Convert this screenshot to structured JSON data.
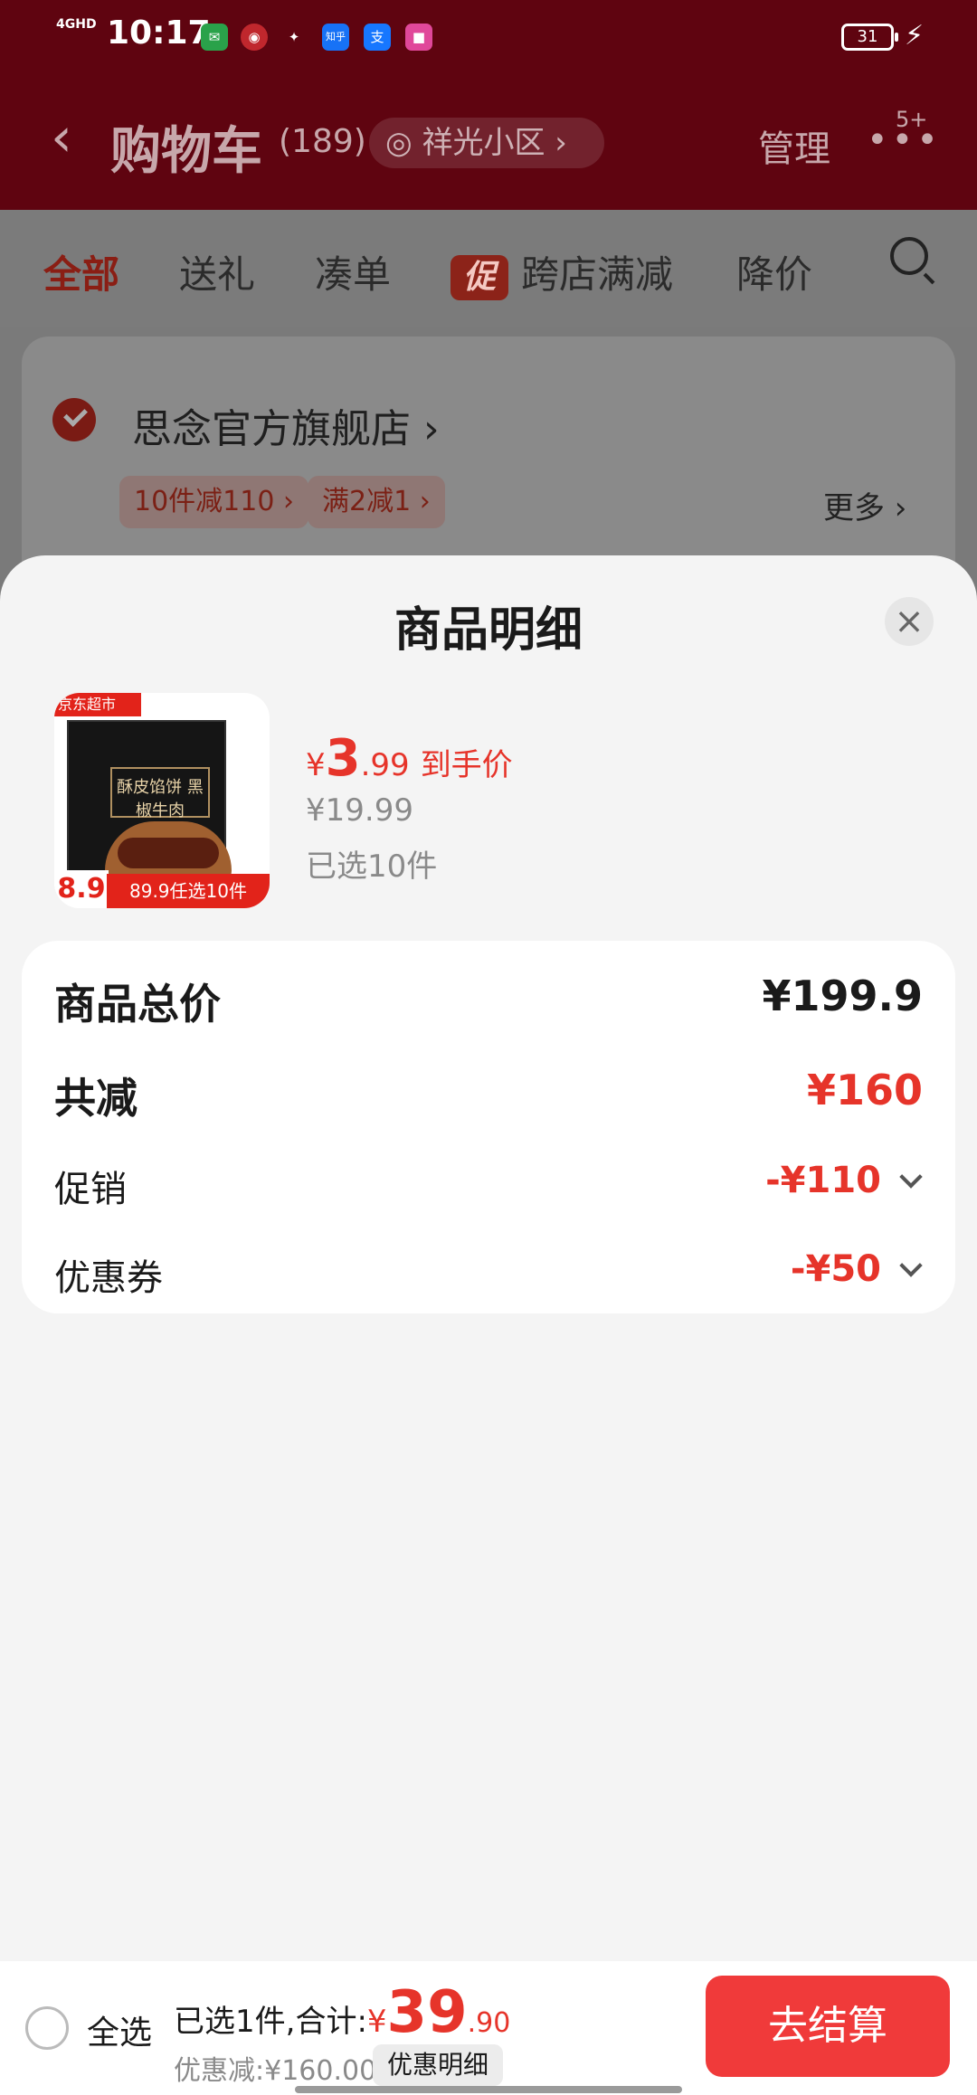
{
  "status_bar": {
    "signal": "4GHD",
    "time": "10:17",
    "battery": "31",
    "app_icons": [
      {
        "name": "postal-icon",
        "color": "#2aa24a",
        "glyph": "✉"
      },
      {
        "name": "chinese-unicom-icon",
        "color": "#c0272d",
        "glyph": "◉"
      },
      {
        "name": "handshake-icon",
        "color": "#444444",
        "glyph": "✦"
      },
      {
        "name": "zhihu-icon",
        "color": "#1772f6",
        "glyph": "知乎"
      },
      {
        "name": "alipay-icon",
        "color": "#1677ff",
        "glyph": "支"
      },
      {
        "name": "app-icon",
        "color": "#e0489a",
        "glyph": "■"
      }
    ]
  },
  "nav": {
    "back_icon": "chevron-left-icon",
    "title": "购物车",
    "count": "(189)",
    "location": "祥光小区",
    "manage": "管理",
    "badge": "5+"
  },
  "tabs": {
    "items": [
      {
        "label": "全部",
        "active": true
      },
      {
        "label": "送礼",
        "active": false
      },
      {
        "label": "凑单",
        "active": false
      },
      {
        "label": "跨店满减",
        "active": false,
        "promo_mark": "促"
      },
      {
        "label": "降价",
        "active": false
      }
    ]
  },
  "store": {
    "name": "思念官方旗舰店",
    "coupons": [
      "10件减110",
      "满2减1"
    ],
    "more": "更多"
  },
  "sheet": {
    "title": "商品明细",
    "product": {
      "image_badge_top": "京东超市",
      "image_pkg_label": "酥皮馅饼\n黑椒牛肉",
      "image_price_tag": "8.9",
      "image_banner": "89.9任选10件",
      "price_currency": "¥",
      "price_int": "3",
      "price_dec": ".99",
      "price_tag": "到手价",
      "orig_price": "¥19.99",
      "qty": "已选10件"
    },
    "summary": {
      "total_label": "商品总价",
      "total_value": "¥199.9",
      "reduce_label": "共减",
      "reduce_value": "¥160",
      "promo_label": "促销",
      "promo_value": "-¥110",
      "coupon_label": "优惠券",
      "coupon_value": "-¥50"
    }
  },
  "checkout": {
    "select_all": "全选",
    "summary_text": "已选1件,合计:",
    "currency": "¥",
    "total_int": "39",
    "total_dec": ".90",
    "discount": "优惠减:¥160.00",
    "detail_button": "优惠明细",
    "checkout_button": "去结算"
  },
  "colors": {
    "accent": "#e6342a",
    "checkout_button": "#f03a3a"
  }
}
